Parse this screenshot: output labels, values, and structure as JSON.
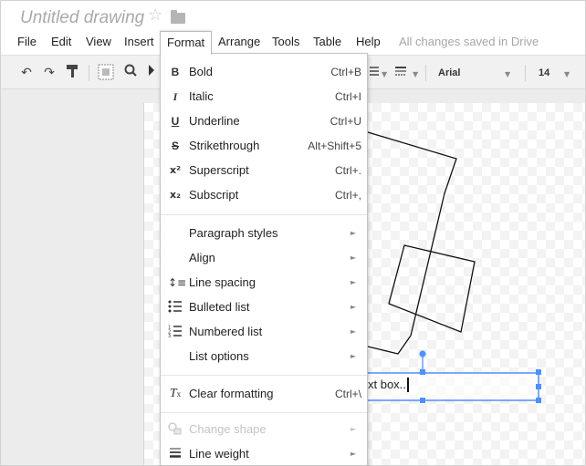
{
  "document": {
    "title": "Untitled drawing"
  },
  "menubar": {
    "items": [
      "File",
      "Edit",
      "View",
      "Insert",
      "Format",
      "Arrange",
      "Tools",
      "Table",
      "Help"
    ],
    "active": "Format",
    "save_status": "All changes saved in Drive"
  },
  "toolbar": {
    "font": "Arial",
    "font_size": "14"
  },
  "format_menu": {
    "items": [
      {
        "icon": "bold-icon",
        "label": "Bold",
        "shortcut": "Ctrl+B"
      },
      {
        "icon": "italic-icon",
        "label": "Italic",
        "shortcut": "Ctrl+I"
      },
      {
        "icon": "underline-icon",
        "label": "Underline",
        "shortcut": "Ctrl+U"
      },
      {
        "icon": "strikethrough-icon",
        "label": "Strikethrough",
        "shortcut": "Alt+Shift+5"
      },
      {
        "icon": "superscript-icon",
        "label": "Superscript",
        "shortcut": "Ctrl+."
      },
      {
        "icon": "subscript-icon",
        "label": "Subscript",
        "shortcut": "Ctrl+,"
      },
      {
        "icon": "",
        "label": "Paragraph styles",
        "submenu": true
      },
      {
        "icon": "",
        "label": "Align",
        "submenu": true
      },
      {
        "icon": "line-spacing-icon",
        "label": "Line spacing",
        "submenu": true
      },
      {
        "icon": "bulleted-list-icon",
        "label": "Bulleted list",
        "submenu": true
      },
      {
        "icon": "numbered-list-icon",
        "label": "Numbered list",
        "submenu": true
      },
      {
        "icon": "",
        "label": "List options",
        "submenu": true
      },
      {
        "icon": "clear-formatting-icon",
        "label": "Clear formatting",
        "shortcut": "Ctrl+\\"
      },
      {
        "icon": "change-shape-icon",
        "label": "Change shape",
        "submenu": true,
        "disabled": true
      },
      {
        "icon": "line-weight-icon",
        "label": "Line weight",
        "submenu": true
      }
    ]
  },
  "canvas": {
    "textbox_text": "xt box.."
  },
  "colors": {
    "selection": "#4d90fe",
    "title_gray": "#a9a9a9",
    "toolbar_bg": "#f1f1f1"
  }
}
